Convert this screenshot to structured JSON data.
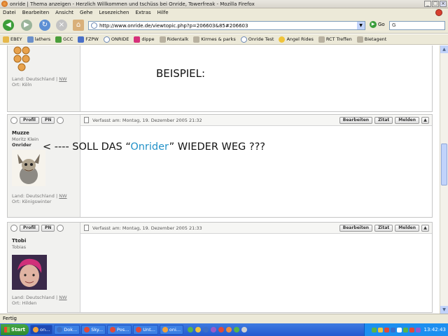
{
  "window": {
    "title": "onride | Thema anzeigen - Herzlich Willkommen und tschüss bei Onride, Towerfreak - Mozilla Firefox"
  },
  "menu": [
    "Datei",
    "Bearbeiten",
    "Ansicht",
    "Gehe",
    "Lesezeichen",
    "Extras",
    "Hilfe"
  ],
  "nav": {
    "url": "http://www.onride.de/viewtopic.php?p=206603&85#206603",
    "go_label": "Go",
    "search_value": "G"
  },
  "bookmarks": [
    "EBEY",
    "lathers",
    "GCC",
    "FZPW",
    "ONRIDE",
    "dippe",
    "Ridentalk",
    "Kirmes & parks",
    "Onride Test",
    "Angel Rides",
    "RCT Treffen",
    "Bietagent"
  ],
  "posts": [
    {
      "country": "Land: Deutschland",
      "country_code": "NW",
      "city": "Ort: Köln"
    },
    {
      "profile_btn": "Profil",
      "pm_btn": "PN",
      "username": "Muzze",
      "realname": "Moritz Klein",
      "rank": "Onrider",
      "posted": "Verfasst am: Montag, 19. Dezember 2005 21:32",
      "edit_btn": "Bearbeiten",
      "quote_btn": "Zitat",
      "report_btn": "Melden",
      "country": "Land: Deutschland",
      "country_code": "NW",
      "city": "Ort: Königswinter"
    },
    {
      "profile_btn": "Profil",
      "pm_btn": "PN",
      "username": "Ttobi",
      "realname": "Tobias",
      "posted": "Verfasst am: Montag, 19. Dezember 2005 21:33",
      "edit_btn": "Bearbeiten",
      "quote_btn": "Zitat",
      "report_btn": "Melden",
      "country": "Land: Deutschland",
      "country_code": "NW",
      "city": "Ort: Hilden"
    }
  ],
  "annotation": {
    "beispiel": "BEISPIEL:",
    "arrow_prefix": "< ---- SOLL DAS “",
    "highlight": "Onrider",
    "arrow_suffix": "” WIEDER WEG ???"
  },
  "status": "Fertig",
  "taskbar": {
    "start": "Start",
    "tasks": [
      "on...",
      "Dok...",
      "Sky...",
      "Pos...",
      "Unt...",
      "oni..."
    ],
    "clock": "13:42:43"
  },
  "colors": {
    "highlight": "#2291c8",
    "taskbar": "#245ad0"
  }
}
